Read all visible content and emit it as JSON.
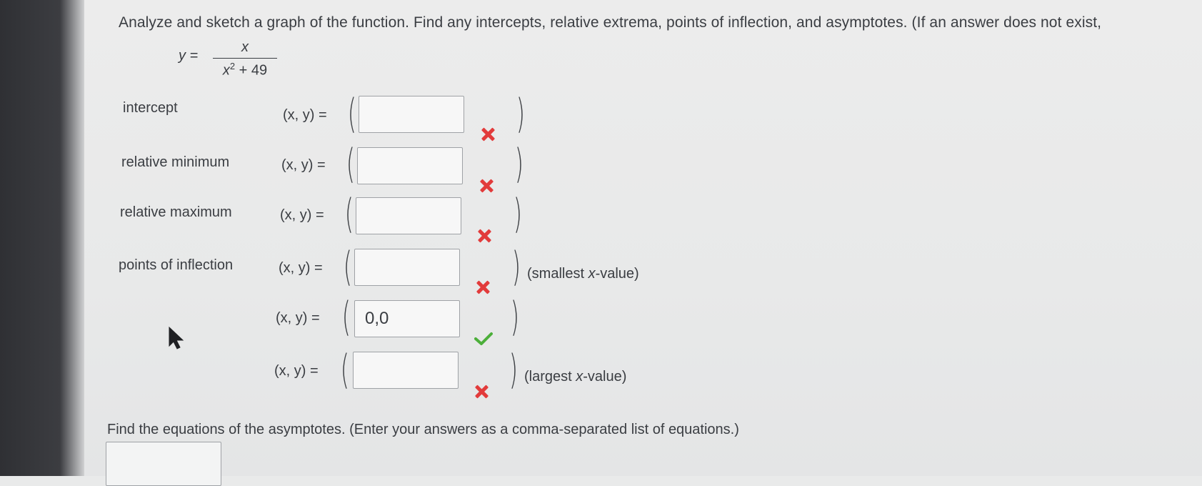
{
  "question": {
    "prompt": "Analyze and sketch a graph of the function. Find any intercepts, relative extrema, points of inflection, and asymptotes. (If an answer does not exist,",
    "formula": {
      "lhs": "y =",
      "numerator": "x",
      "denominator_var": "x",
      "denominator_exp": "2",
      "denominator_rest": "+ 49"
    }
  },
  "rows": [
    {
      "label": "intercept",
      "lhs": "(x, y) =",
      "value": "",
      "status": "incorrect",
      "suffix": ""
    },
    {
      "label": "relative minimum",
      "lhs": "(x, y) =",
      "value": "",
      "status": "incorrect",
      "suffix": ""
    },
    {
      "label": "relative maximum",
      "lhs": "(x, y) =",
      "value": "",
      "status": "incorrect",
      "suffix": ""
    },
    {
      "label": "points of inflection",
      "lhs": "(x, y) =",
      "value": "",
      "status": "incorrect",
      "suffix_pre": "(smallest ",
      "suffix_var": "x",
      "suffix_post": "-value)"
    },
    {
      "label": "",
      "lhs": "(x, y) =",
      "value": "0,0",
      "status": "correct",
      "suffix": ""
    },
    {
      "label": "",
      "lhs": "(x, y) =",
      "value": "",
      "status": "incorrect",
      "suffix_pre": "(largest ",
      "suffix_var": "x",
      "suffix_post": "-value)"
    }
  ],
  "asymptotes": {
    "prompt": "Find the equations of the asymptotes. (Enter your answers as a comma-separated list of equations.)",
    "value": ""
  },
  "colors": {
    "incorrect": "#e23b3b",
    "correct": "#4caf3a",
    "text": "#3a3d42"
  },
  "icons": {
    "incorrect": "x-mark-icon",
    "correct": "check-mark-icon",
    "cursor": "mouse-pointer-icon"
  }
}
